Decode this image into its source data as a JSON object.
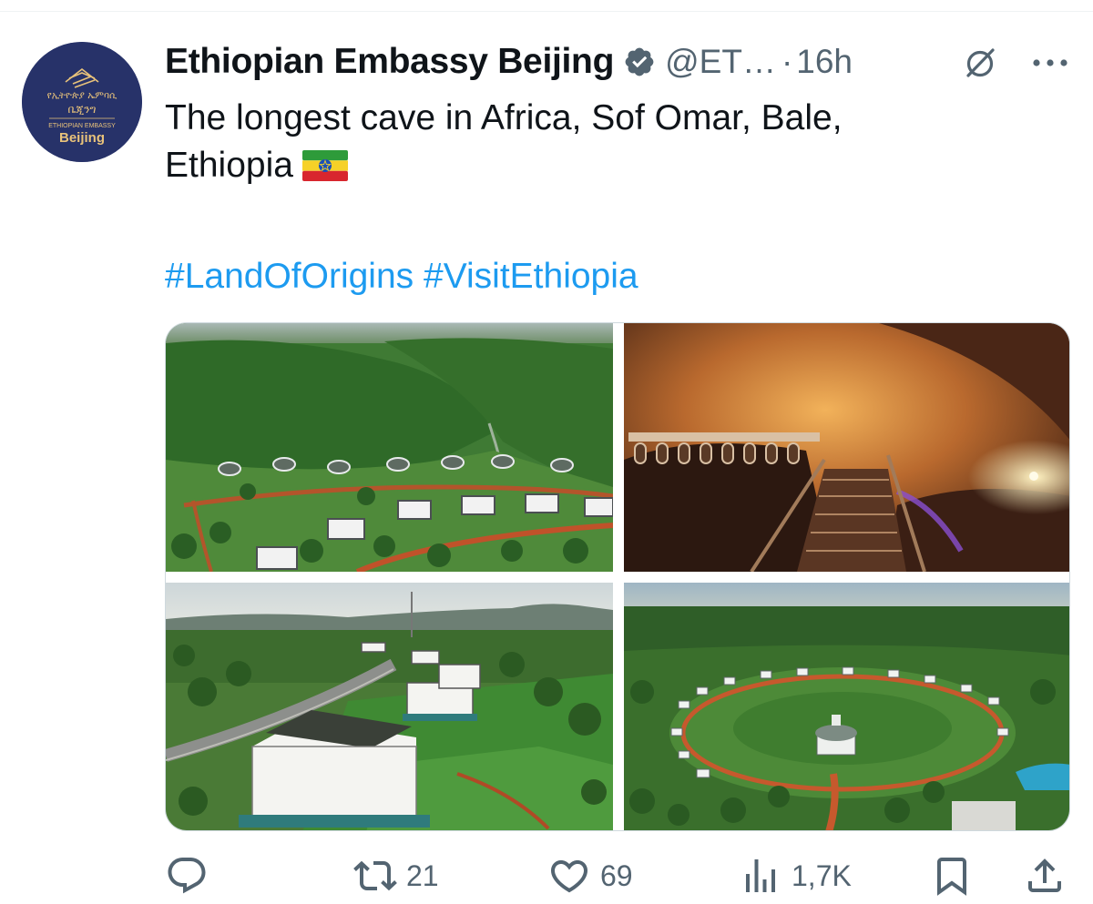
{
  "tweet": {
    "author": {
      "display_name": "Ethiopian Embassy Beijing",
      "handle": "@ET…",
      "verified": true,
      "avatar": {
        "line1": "የኢትዮጵያ ኤምባሲ",
        "line2": "ቤጂንግ",
        "line3": "ETHIOPIAN EMBASSY",
        "line4": "Beijing",
        "bg_color": "#273269",
        "text_color": "#e8c27a"
      }
    },
    "separator": "·",
    "time": "16h",
    "text_line1": "The longest cave in Africa, Sof Omar, Bale,",
    "text_line2": "Ethiopia",
    "flag_icon": "ethiopia-flag",
    "hashtags": [
      "#LandOfOrigins",
      "#VisitEthiopia"
    ],
    "media": [
      {
        "icon": "photo",
        "subject": "aerial-green-valley-lodges"
      },
      {
        "icon": "photo",
        "subject": "cave-interior-stairs"
      },
      {
        "icon": "photo",
        "subject": "lodge-buildings-roadside"
      },
      {
        "icon": "photo",
        "subject": "circular-resort-aerial"
      }
    ],
    "actions": {
      "reply": {
        "icon": "reply-icon",
        "count": ""
      },
      "retweet": {
        "icon": "retweet-icon",
        "count": "21"
      },
      "like": {
        "icon": "heart-icon",
        "count": "69"
      },
      "views": {
        "icon": "views-icon",
        "count": "1,7K"
      },
      "bookmark": {
        "icon": "bookmark-icon"
      },
      "share": {
        "icon": "share-icon"
      }
    }
  },
  "colors": {
    "text": "#0f1419",
    "secondary": "#536471",
    "link": "#1d9bf0",
    "verified_badge": "#536471",
    "border": "#cfd9de"
  }
}
